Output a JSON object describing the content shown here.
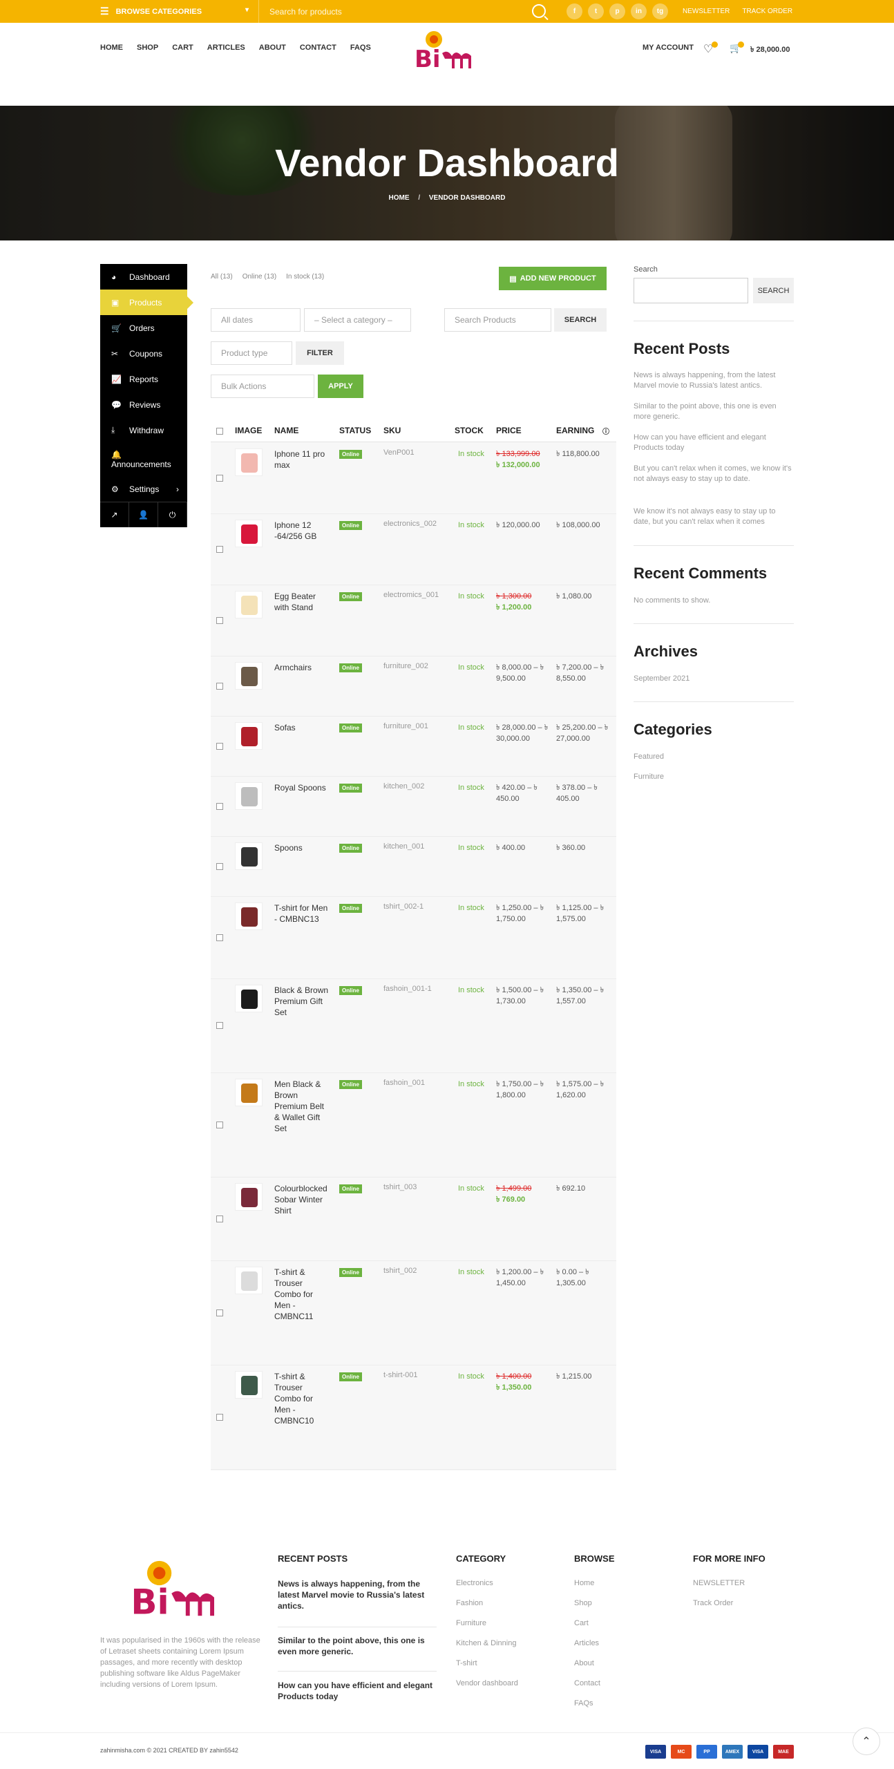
{
  "topbar": {
    "browse": "BROWSE CATEGORIES",
    "search_placeholder": "Search for products",
    "socials": [
      "f",
      "t",
      "p",
      "in",
      "tg"
    ],
    "newsletter": "NEWSLETTER",
    "track": "TRACK ORDER"
  },
  "nav": [
    "HOME",
    "SHOP",
    "CART",
    "ARTICLES",
    "ABOUT",
    "CONTACT",
    "FAQS"
  ],
  "brand": {
    "logo_text": "Bi জ্ঞাপন",
    "accent": "#c2185b"
  },
  "header": {
    "account": "MY ACCOUNT",
    "cart_total": "৳ 28,000.00"
  },
  "hero": {
    "title": "Vendor Dashboard",
    "crumb_home": "HOME",
    "crumb_sep": "/",
    "crumb_current": "VENDOR DASHBOARD"
  },
  "sidebar": {
    "items": [
      {
        "icon": "◕",
        "label": "Dashboard"
      },
      {
        "icon": "▣",
        "label": "Products"
      },
      {
        "icon": "🛒",
        "label": "Orders"
      },
      {
        "icon": "✂",
        "label": "Coupons"
      },
      {
        "icon": "📈",
        "label": "Reports"
      },
      {
        "icon": "💬",
        "label": "Reviews"
      },
      {
        "icon": "⤓",
        "label": "Withdraw"
      },
      {
        "icon": "🔔",
        "label": "Announcements"
      },
      {
        "icon": "⚙",
        "label": "Settings",
        "chev": "›"
      }
    ],
    "footer_icons": [
      "↗",
      "👤",
      "⏻"
    ]
  },
  "products_page": {
    "filters": [
      "All (13)",
      "Online (13)",
      "In stock (13)"
    ],
    "add_new": "ADD NEW PRODUCT",
    "dates": "All dates",
    "category": "– Select a category –",
    "search_placeholder": "Search Products",
    "search_btn": "SEARCH",
    "type": "Product type",
    "filter_btn": "FILTER",
    "bulk": "Bulk Actions",
    "apply": "APPLY",
    "columns": [
      "IMAGE",
      "NAME",
      "STATUS",
      "SKU",
      "STOCK",
      "PRICE",
      "EARNING"
    ],
    "rows": [
      {
        "name": "Iphone 11 pro max",
        "status": "Online",
        "sku": "VenP001",
        "stock": "In stock",
        "price_old": "৳ 133,999.00",
        "price": "৳ 132,000.00",
        "earning": "৳ 118,800.00",
        "color": "#f2b8b0"
      },
      {
        "name": "Iphone 12 -64/256 GB",
        "status": "Online",
        "sku": "electronics_002",
        "stock": "In stock",
        "price_old": "",
        "price": "৳ 120,000.00",
        "earning": "৳ 108,000.00",
        "color": "#d8173b"
      },
      {
        "name": "Egg Beater with Stand",
        "status": "Online",
        "sku": "electromics_001",
        "stock": "In stock",
        "price_old": "৳ 1,300.00",
        "price": "৳ 1,200.00",
        "earning": "৳ 1,080.00",
        "color": "#f4e2b8"
      },
      {
        "name": "Armchairs",
        "status": "Online",
        "sku": "furniture_002",
        "stock": "In stock",
        "price_old": "",
        "price": "৳ 8,000.00 – ৳ 9,500.00",
        "earning": "৳ 7,200.00 – ৳ 8,550.00",
        "color": "#6b5a48"
      },
      {
        "name": "Sofas",
        "status": "Online",
        "sku": "furniture_001",
        "stock": "In stock",
        "price_old": "",
        "price": "৳ 28,000.00 – ৳ 30,000.00",
        "earning": "৳ 25,200.00 – ৳ 27,000.00",
        "color": "#b0202a"
      },
      {
        "name": "Royal Spoons",
        "status": "Online",
        "sku": "kitchen_002",
        "stock": "In stock",
        "price_old": "",
        "price": "৳ 420.00 – ৳ 450.00",
        "earning": "৳ 378.00 – ৳ 405.00",
        "color": "#bdbdbd"
      },
      {
        "name": "Spoons",
        "status": "Online",
        "sku": "kitchen_001",
        "stock": "In stock",
        "price_old": "",
        "price": "৳ 400.00",
        "earning": "৳ 360.00",
        "color": "#333333"
      },
      {
        "name": "T-shirt for Men - CMBNC13",
        "status": "Online",
        "sku": "tshirt_002-1",
        "stock": "In stock",
        "price_old": "",
        "price": "৳ 1,250.00 – ৳ 1,750.00",
        "earning": "৳ 1,125.00 – ৳ 1,575.00",
        "color": "#7a2a2a"
      },
      {
        "name": "Black & Brown Premium Gift Set",
        "status": "Online",
        "sku": "fashoin_001-1",
        "stock": "In stock",
        "price_old": "",
        "price": "৳ 1,500.00 – ৳ 1,730.00",
        "earning": "৳ 1,350.00 – ৳ 1,557.00",
        "color": "#1c1c1c"
      },
      {
        "name": "Men Black & Brown Premium Belt & Wallet Gift Set",
        "status": "Online",
        "sku": "fashoin_001",
        "stock": "In stock",
        "price_old": "",
        "price": "৳ 1,750.00 – ৳ 1,800.00",
        "earning": "৳ 1,575.00 – ৳ 1,620.00",
        "color": "#c47a1a"
      },
      {
        "name": "Colourblocked Sobar Winter Shirt",
        "status": "Online",
        "sku": "tshirt_003",
        "stock": "In stock",
        "price_old": "৳ 1,499.00",
        "price": "৳ 769.00",
        "earning": "৳ 692.10",
        "color": "#7a2a3a"
      },
      {
        "name": "T-shirt & Trouser Combo for Men - CMBNC11",
        "status": "Online",
        "sku": "tshirt_002",
        "stock": "In stock",
        "price_old": "",
        "price": "৳ 1,200.00 – ৳ 1,450.00",
        "earning": "৳ 0.00 – ৳ 1,305.00",
        "color": "#dcdcdc"
      },
      {
        "name": "T-shirt & Trouser Combo for Men - CMBNC10",
        "status": "Online",
        "sku": "t-shirt-001",
        "stock": "In stock",
        "price_old": "৳ 1,400.00",
        "price": "৳ 1,350.00",
        "earning": "৳ 1,215.00",
        "color": "#3e5a4a"
      }
    ]
  },
  "right_sidebar": {
    "search_label": "Search",
    "search_btn": "SEARCH",
    "recent_posts_title": "Recent Posts",
    "recent_posts": [
      "News is always happening, from the latest Marvel movie to Russia's latest antics.",
      "Similar to the point above, this one is even more generic.",
      "How can you have efficient and elegant Products today",
      "But you can't relax when it comes, we know it's not always easy to stay up to date.",
      "We know it's not always easy to stay up to date, but you can't relax when it comes"
    ],
    "recent_comments_title": "Recent Comments",
    "no_comments": "No comments to show.",
    "archives_title": "Archives",
    "archive": "September 2021",
    "categories_title": "Categories",
    "categories": [
      "Featured",
      "Furniture"
    ]
  },
  "footer": {
    "about": "It was popularised in the 1960s with the release of Letraset sheets containing Lorem Ipsum passages, and more recently with desktop publishing software like Aldus PageMaker including versions of Lorem Ipsum.",
    "recent_title": "RECENT POSTS",
    "recent": [
      "News is always happening, from the latest Marvel movie to Russia's latest antics.",
      "Similar to the point above, this one is even more generic.",
      "How can you have efficient and elegant Products today"
    ],
    "cat_title": "CATEGORY",
    "cats": [
      "Electronics",
      "Fashion",
      "Furniture",
      "Kitchen & Dinning",
      "T-shirt",
      "Vendor dashboard"
    ],
    "browse_title": "BROWSE",
    "browse": [
      "Home",
      "Shop",
      "Cart",
      "Articles",
      "About",
      "Contact",
      "FAQs"
    ],
    "more_title": "FOR MORE INFO",
    "more": [
      "NEWSLETTER",
      "Track Order"
    ],
    "copy": "zahinmisha.com © 2021 CREATED BY zahin5542",
    "payments": [
      {
        "name": "VISA",
        "color": "#1a3d8f"
      },
      {
        "name": "MC",
        "color": "#e64a19"
      },
      {
        "name": "PP",
        "color": "#2a6fd6"
      },
      {
        "name": "AMEX",
        "color": "#2e77bb"
      },
      {
        "name": "VISA",
        "color": "#0d47a1"
      },
      {
        "name": "MAE",
        "color": "#c62828"
      }
    ]
  }
}
